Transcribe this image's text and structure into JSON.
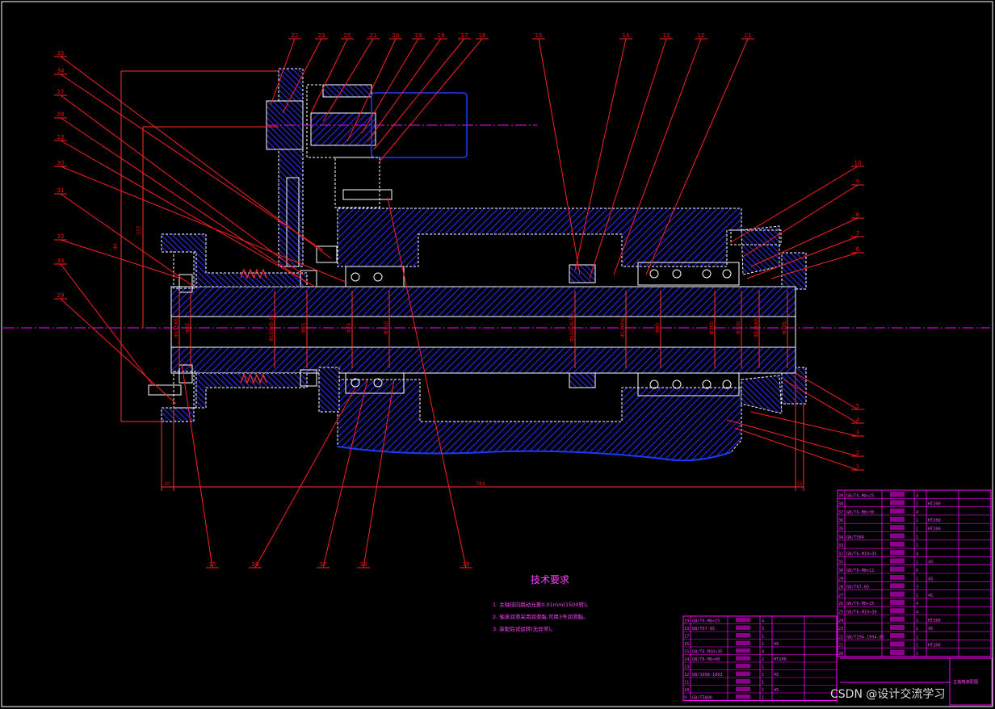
{
  "colors": {
    "background": "#000000",
    "frame": "#ffffff",
    "outline": "#ffffff",
    "hatch": "#2020ff",
    "leader": "#ff0000",
    "centerline": "#ff00ff",
    "table": "#ff00ff",
    "notes": "#ff40ff"
  },
  "left_callouts": [
    {
      "label": "35",
      "text_at": "left"
    },
    {
      "label": "34",
      "text_at": "left"
    },
    {
      "label": "27",
      "text_at": "left"
    },
    {
      "label": "28",
      "text_at": "left"
    },
    {
      "label": "23",
      "text_at": "left"
    },
    {
      "label": "30",
      "text_at": "left"
    },
    {
      "label": "31",
      "text_at": "left"
    },
    {
      "label": "32",
      "text_at": "left"
    },
    {
      "label": "33",
      "text_at": "left"
    },
    {
      "label": "29",
      "text_at": "left"
    }
  ],
  "top_callouts": [
    "22",
    "23",
    "25",
    "21",
    "20",
    "19",
    "18",
    "17",
    "16",
    "15",
    "14",
    "13",
    "12",
    "11"
  ],
  "right_callouts": [
    "10",
    "9",
    "8",
    "7",
    "6",
    "5",
    "4",
    "3",
    "2",
    "1"
  ],
  "bottom_callouts": [
    "35",
    "36",
    "37",
    "38",
    "39"
  ],
  "dimensions": {
    "overall_length": "784",
    "left_offset": "10",
    "right_offset": "15",
    "height_a": "40",
    "height_b": "237",
    "shaft_diameters": [
      "Φ105K6",
      "Φ65",
      "Φ100K6-5a",
      "Φ65",
      "Φ75",
      "Φ110",
      "Φ100G6-5a",
      "Φ120h6",
      "Φ90",
      "Φ100",
      "Φ130",
      "Φ120K6",
      "Φ100"
    ]
  },
  "tech_requirements": {
    "title": "技术要求",
    "items": [
      "1. 主轴径向跳动允差0.01mm(1500转)。",
      "2. 轴承润滑采用润滑脂,可用3号润滑脂。",
      "3. 装配后试运转(无异常)。"
    ]
  },
  "bom_right": {
    "rows": [
      [
        "39",
        "GB/T6-M8×25",
        "",
        "4",
        ""
      ],
      [
        "38",
        "",
        "",
        "1",
        "HT200"
      ],
      [
        "37",
        "GB/T6-M8×30",
        "",
        "4",
        ""
      ],
      [
        "36",
        "",
        "",
        "1",
        "HT200"
      ],
      [
        "35",
        "",
        "",
        "1",
        "HT200"
      ],
      [
        "34",
        "GB/T584",
        "",
        "1",
        ""
      ],
      [
        "33",
        "",
        "",
        "1",
        ""
      ],
      [
        "32",
        "GB/T6-M10×35",
        "",
        "4",
        ""
      ],
      [
        "31",
        "",
        "",
        "1",
        "45"
      ],
      [
        "30",
        "GB/T6-M8×12",
        "",
        "6",
        ""
      ],
      [
        "29",
        "",
        "",
        "1",
        "45"
      ],
      [
        "28",
        "GB/T67-85",
        "",
        "3",
        ""
      ],
      [
        "27",
        "",
        "",
        "1",
        "45"
      ],
      [
        "26",
        "GB/T6-M8×25",
        "",
        "4",
        ""
      ],
      [
        "25",
        "GB/T6-M10×30",
        "",
        "4",
        ""
      ],
      [
        "24",
        "",
        "",
        "1",
        "HT200"
      ],
      [
        "23",
        "",
        "",
        "1",
        "45"
      ],
      [
        "22",
        "GB/T294-1994-85",
        "",
        "2",
        ""
      ],
      [
        "21",
        "",
        "",
        "1",
        "HT200"
      ],
      [
        "20",
        "",
        "",
        "1",
        ""
      ]
    ]
  },
  "bom_bottom": {
    "rows": [
      [
        "19",
        "GB/T6-M8×25",
        "",
        "4",
        ""
      ],
      [
        "18",
        "GB/T67-85",
        "",
        "3",
        ""
      ],
      [
        "17",
        "",
        "",
        "1",
        ""
      ],
      [
        "16",
        "",
        "",
        "1",
        "45"
      ],
      [
        "15",
        "GB/T6-M10×35",
        "",
        "4",
        ""
      ],
      [
        "14",
        "GB/T6-M8×40",
        "",
        "2",
        "HT200"
      ],
      [
        "13",
        "",
        "",
        "1",
        ""
      ],
      [
        "12",
        "GB/1098-1003",
        "",
        "1",
        "45"
      ],
      [
        "11",
        "",
        "",
        "1",
        ""
      ],
      [
        "10",
        "",
        "",
        "1",
        "45"
      ],
      [
        "9",
        "GB/T5800",
        "",
        "1",
        ""
      ]
    ]
  },
  "title_block": {
    "drawing_name": "主轴箱装配图"
  },
  "watermark": "CSDN @设计交流学习"
}
